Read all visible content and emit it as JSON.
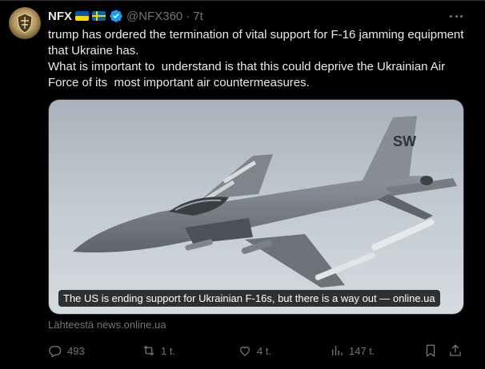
{
  "tweet": {
    "author_name": "NFX",
    "flags": [
      "ukraine-flag",
      "sweden-flag"
    ],
    "verified": true,
    "handle": "@NFX360",
    "separator": "·",
    "time": "7t",
    "text_line1": "trump has ordered the termination of vital support for F-16 jamming equipment that Ukraine has.",
    "text_line2": "What is important to  understand is that this could deprive the Ukrainian Air Force of its  most important air countermeasures."
  },
  "card": {
    "caption": "The US is ending support for Ukrainian F-16s, but there is a way out — online.ua",
    "tail_code": "SW",
    "source_text": "Lähteestä news.online.ua"
  },
  "actions": {
    "replies": "493",
    "retweets": "1 t.",
    "likes": "4 t.",
    "views": "147 t."
  },
  "colors": {
    "background": "#000000",
    "text": "#e7e9ea",
    "muted": "#71767b",
    "verified": "#1d9bf0"
  },
  "icons": [
    "more-icon",
    "verified-icon",
    "reply-icon",
    "retweet-icon",
    "like-icon",
    "views-icon",
    "bookmark-icon",
    "share-icon"
  ]
}
